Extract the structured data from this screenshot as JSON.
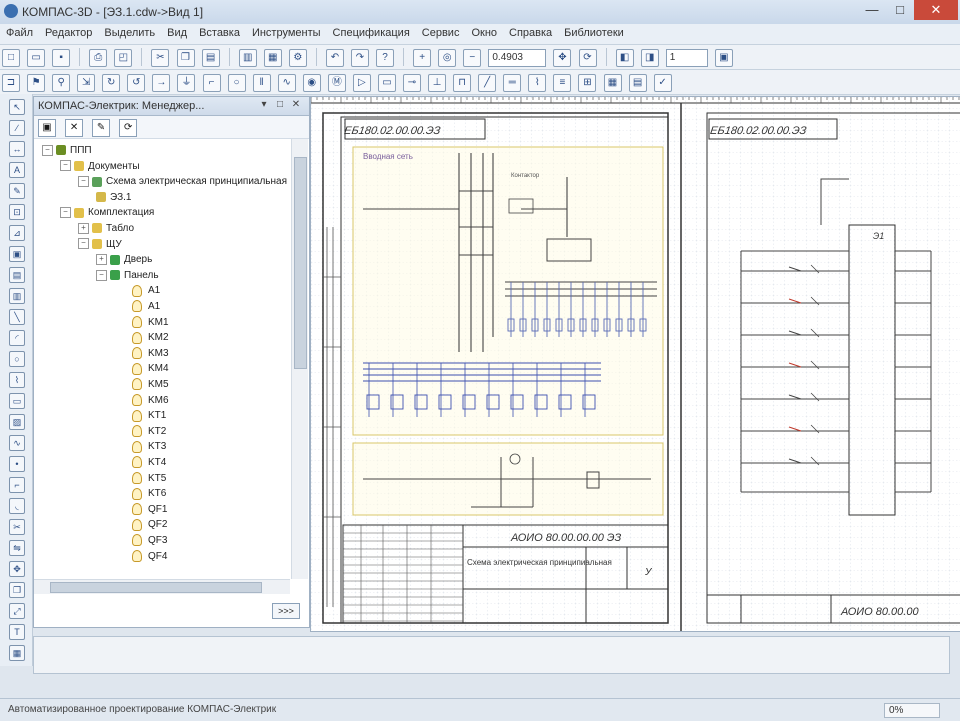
{
  "window": {
    "title": "КОМПАС-3D - [ЭЗ.1.cdw->Вид 1]",
    "minimize": "—",
    "maximize": "□",
    "close": "✕"
  },
  "menu": [
    "Файл",
    "Редактор",
    "Выделить",
    "Вид",
    "Вставка",
    "Инструменты",
    "Спецификация",
    "Сервис",
    "Окно",
    "Справка",
    "Библиотеки"
  ],
  "toolbar": {
    "zoom_value": "0.4903",
    "layer_value": "1"
  },
  "manager": {
    "title": "КОМПАС-Электрик: Менеджер...",
    "tree": [
      {
        "label": "ППП",
        "level": 0,
        "toggle": "−",
        "icon": "project-icon"
      },
      {
        "label": "Документы",
        "level": 1,
        "toggle": "−",
        "icon": "folder-icon"
      },
      {
        "label": "Схема электрическая принципиальная",
        "level": 2,
        "toggle": "−",
        "icon": "schema-icon"
      },
      {
        "label": "ЭЗ.1",
        "level": 3,
        "toggle": "",
        "icon": "sheet-icon"
      },
      {
        "label": "Комплектация",
        "level": 1,
        "toggle": "−",
        "icon": "folder-icon"
      },
      {
        "label": "Табло",
        "level": 2,
        "toggle": "+",
        "icon": "device-icon"
      },
      {
        "label": "ЩУ",
        "level": 2,
        "toggle": "−",
        "icon": "device-icon"
      },
      {
        "label": "Дверь",
        "level": 3,
        "toggle": "+",
        "icon": "green-icon"
      },
      {
        "label": "Панель",
        "level": 3,
        "toggle": "−",
        "icon": "green-icon"
      }
    ],
    "components": [
      "A1",
      "A1",
      "KM1",
      "KM2",
      "KM3",
      "KM4",
      "KM5",
      "KM6",
      "KT1",
      "KT2",
      "KT3",
      "KT4",
      "KT5",
      "KT6",
      "QF1",
      "QF2",
      "QF3",
      "QF4"
    ],
    "panel_button": ">>>"
  },
  "drawing": {
    "sheet1_code": "ЕБ180.02.00.00.ЭЗ",
    "sheet2_code": "ЕБ180.02.00.00.ЭЗ",
    "stamp_designation": "АОИО 80.00.00.00 ЭЗ",
    "stamp_title": "Схема электрическая принципиальная",
    "stamp_sheet_mark": "У",
    "label_top": "Вводная сеть",
    "label_block": "Э1",
    "right_designation": "АОИО 80.00.00"
  },
  "status": {
    "text": "Автоматизированное проектирование КОМПАС-Электрик",
    "zoom": "0%"
  }
}
